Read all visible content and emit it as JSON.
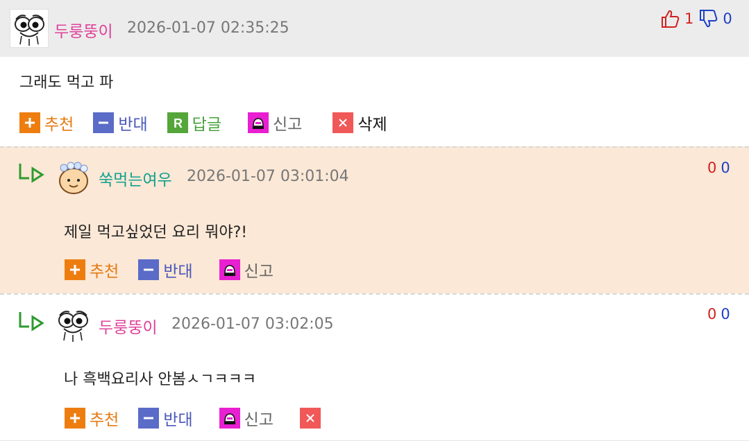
{
  "comments": [
    {
      "nickname": "두룽뚱이",
      "timestamp": "2026-01-07 02:35:25",
      "body": "그래도 먹고 파",
      "upvotes": "1",
      "downvotes": "0",
      "actions": {
        "recommend": "추천",
        "oppose": "반대",
        "reply": "답글",
        "report": "신고",
        "delete": "삭제"
      }
    },
    {
      "nickname": "쑥먹는여우",
      "timestamp": "2026-01-07 03:01:04",
      "body": "제일 먹고싶었던 요리 뭐야?!",
      "upvotes": "0",
      "downvotes": "0",
      "actions": {
        "recommend": "추천",
        "oppose": "반대",
        "report": "신고"
      }
    },
    {
      "nickname": "두룽뚱이",
      "timestamp": "2026-01-07 03:02:05",
      "body": "나 흑백요리사 안봄ㅅㄱㅋㅋㅋ",
      "upvotes": "0",
      "downvotes": "0",
      "actions": {
        "recommend": "추천",
        "oppose": "반대",
        "report": "신고"
      }
    }
  ],
  "colors": {
    "recommend": "#ee7d10",
    "oppose": "#5a6bc8",
    "reply": "#54a63a",
    "report": "#e91fd2",
    "delete": "#f15858",
    "nick_pink": "#e0409a",
    "nick_teal": "#12a08f",
    "reply_bg": "#fbe8d6"
  },
  "icons": [
    "avatar-googly-eyes",
    "avatar-fox",
    "thumbs-up-icon",
    "thumbs-down-icon",
    "reply-arrow-icon",
    "plus-icon",
    "minus-icon",
    "reply-r-icon",
    "siren-icon",
    "x-icon"
  ]
}
